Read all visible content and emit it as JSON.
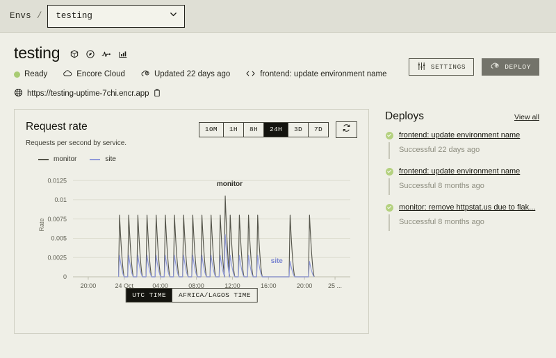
{
  "topbar": {
    "breadcrumb_root": "Envs",
    "breadcrumb_separator": "/",
    "env_selected": "testing"
  },
  "header": {
    "title": "testing",
    "icons": [
      "cube-icon",
      "compass-icon",
      "activity-icon",
      "bar-chart-icon"
    ],
    "status_label": "Ready",
    "cloud_label": "Encore Cloud",
    "updated_label": "Updated 22 days ago",
    "commit_label": "frontend: update environment name",
    "url": "https://testing-uptime-7chi.encr.app",
    "settings_label": "SETTINGS",
    "deploy_label": "DEPLOY",
    "status_color": "#A8CB73"
  },
  "chart_card": {
    "title": "Request rate",
    "subtitle": "Requests per second by service.",
    "ranges": [
      "10M",
      "1H",
      "8H",
      "24H",
      "3D",
      "7D"
    ],
    "active_range": "24H",
    "refresh_icon": "refresh-icon",
    "timezones": [
      "UTC TIME",
      "AFRICA/LAGOS TIME"
    ],
    "active_timezone": "UTC TIME"
  },
  "chart_data": {
    "type": "line",
    "title": "Request rate",
    "subtitle": "Requests per second by service.",
    "xlabel": "",
    "ylabel": "Rate",
    "ylim": [
      0,
      0.0135
    ],
    "yticks": [
      0,
      0.0025,
      0.005,
      0.0075,
      0.01,
      0.0125
    ],
    "ytick_labels": [
      "0",
      "0.0025",
      "0.005",
      "0.0075",
      "0.01",
      "0.0125"
    ],
    "xtick_labels": [
      "20:00",
      "24 Oct",
      "04:00",
      "08:00",
      "12:00",
      "16:00",
      "20:00",
      "25 ..."
    ],
    "xtick_positions": [
      0.055,
      0.185,
      0.315,
      0.445,
      0.575,
      0.705,
      0.835,
      0.945
    ],
    "grid": true,
    "legend_position": "top-left",
    "annotations": [
      {
        "text": "monitor",
        "x": 0.565,
        "y": 0.0118,
        "color": "#2f2f28"
      },
      {
        "text": "site",
        "x": 0.735,
        "y": 0.0018,
        "color": "#7b86D0"
      }
    ],
    "series": [
      {
        "name": "monitor",
        "color": "#55554B",
        "peak": 0.008,
        "max_peak": 0.0105,
        "baseline": 0,
        "spike_x": [
          0.168,
          0.201,
          0.234,
          0.267,
          0.3,
          0.333,
          0.366,
          0.399,
          0.432,
          0.465,
          0.498,
          0.531,
          0.549,
          0.567,
          0.6,
          0.633,
          0.666,
          0.783,
          0.853
        ],
        "spike_heights": [
          0.008,
          0.008,
          0.008,
          0.008,
          0.008,
          0.008,
          0.008,
          0.008,
          0.008,
          0.008,
          0.008,
          0.008,
          0.0105,
          0.008,
          0.008,
          0.008,
          0.008,
          0.008,
          0.008
        ]
      },
      {
        "name": "site",
        "color": "#8F99DA",
        "peak": 0.0028,
        "baseline": 0,
        "spike_x": [
          0.168,
          0.201,
          0.234,
          0.267,
          0.3,
          0.333,
          0.366,
          0.399,
          0.432,
          0.465,
          0.498,
          0.531,
          0.549,
          0.567,
          0.6,
          0.633,
          0.666,
          0.783,
          0.853
        ],
        "spike_heights": [
          0.0028,
          0.0028,
          0.0028,
          0.0028,
          0.0028,
          0.0028,
          0.0028,
          0.0028,
          0.0028,
          0.0028,
          0.0028,
          0.0028,
          0.0055,
          0.0028,
          0.0028,
          0.0028,
          0.0028,
          0.002,
          0.002
        ]
      }
    ]
  },
  "deploys": {
    "title": "Deploys",
    "view_all": "View all",
    "items": [
      {
        "name": "frontend: update environment name",
        "status": "Successful 22 days ago"
      },
      {
        "name": "frontend: update environment name",
        "status": "Successful 8 months ago"
      },
      {
        "name": "monitor: remove httpstat.us due to flak...",
        "status": "Successful 8 months ago"
      }
    ]
  }
}
